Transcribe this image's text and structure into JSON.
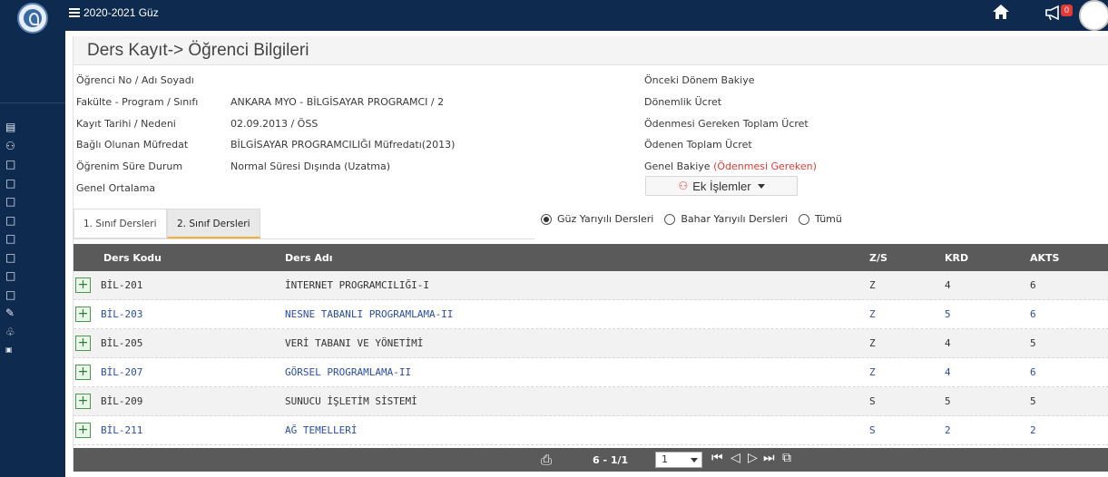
{
  "topbar": {
    "term": "2020-2021 Güz",
    "notification_count": "0",
    "icons": [
      "hamburger-icon",
      "home-icon",
      "megaphone-icon",
      "avatar"
    ]
  },
  "sidebar": {
    "icons": [
      "table-icon",
      "group-icon",
      "square-icon",
      "square-icon",
      "square-icon",
      "square-icon",
      "square-icon",
      "square-icon",
      "square-icon",
      "square-icon",
      "edit-icon",
      "network-icon",
      "atr-icon"
    ]
  },
  "page": {
    "title": "Ders Kayıt-> Öğrenci Bilgileri"
  },
  "student_info": [
    {
      "label": "Öğrenci No / Adı Soyadı",
      "value": ""
    },
    {
      "label": "Fakülte - Program / Sınıfı",
      "value": "ANKARA MYO - BİLGİSAYAR PROGRAMCI / 2"
    },
    {
      "label": "Kayıt Tarihi / Nedeni",
      "value": "02.09.2013 / ÖSS"
    },
    {
      "label": "Bağlı Olunan Müfredat",
      "value": "BİLGİSAYAR PROGRAMCILIĞI Müfredatı(2013)"
    },
    {
      "label": "Öğrenim Süre Durum",
      "value": "Normal Süresi Dışında (Uzatma)"
    },
    {
      "label": "Genel Ortalama",
      "value": ""
    }
  ],
  "finance": {
    "onceki": "Önceki Dönem Bakiye",
    "donemlik": "Dönemlik Ücret",
    "gereken": "Ödenmesi Gereken Toplam Ücret",
    "odenen": "Ödenen Toplam Ücret",
    "genel": "Genel Bakiye",
    "genel_note": "(Ödenmesi Gereken)"
  },
  "ek_button": "Ek İşlemler",
  "tabs": [
    "1. Sınıf Dersleri",
    "2. Sınıf Dersleri"
  ],
  "active_tab": 1,
  "radios": [
    "Güz Yarıyılı Dersleri",
    "Bahar Yarıyılı Dersleri",
    "Tümü"
  ],
  "selected_radio": 0,
  "table": {
    "headers": {
      "code": "Ders Kodu",
      "name": "Ders Adı",
      "zs": "Z/S",
      "krd": "KRD",
      "akts": "AKTS"
    },
    "rows": [
      {
        "code": "BİL-201",
        "name": "İNTERNET PROGRAMCILIĞI-I",
        "zs": "Z",
        "krd": "4",
        "akts": "6"
      },
      {
        "code": "BİL-203",
        "name": "NESNE TABANLI PROGRAMLAMA-II",
        "zs": "Z",
        "krd": "5",
        "akts": "6"
      },
      {
        "code": "BİL-205",
        "name": "VERİ TABANI VE YÖNETİMİ",
        "zs": "Z",
        "krd": "4",
        "akts": "5"
      },
      {
        "code": "BİL-207",
        "name": "GÖRSEL PROGRAMLAMA-II",
        "zs": "Z",
        "krd": "4",
        "akts": "6"
      },
      {
        "code": "BİL-209",
        "name": "SUNUCU İŞLETİM SİSTEMİ",
        "zs": "S",
        "krd": "5",
        "akts": "5"
      },
      {
        "code": "BİL-211",
        "name": "AĞ TEMELLERİ",
        "zs": "S",
        "krd": "2",
        "akts": "2"
      }
    ]
  },
  "pager": {
    "info": "6 - 1/1",
    "page_select": "1"
  },
  "colors": {
    "nav_bg": "#0e2a4e",
    "table_header": "#5a5a5a",
    "link_blue": "#2a4ea6",
    "accent_red": "#e53935",
    "tab_underline": "#f3b13b"
  }
}
